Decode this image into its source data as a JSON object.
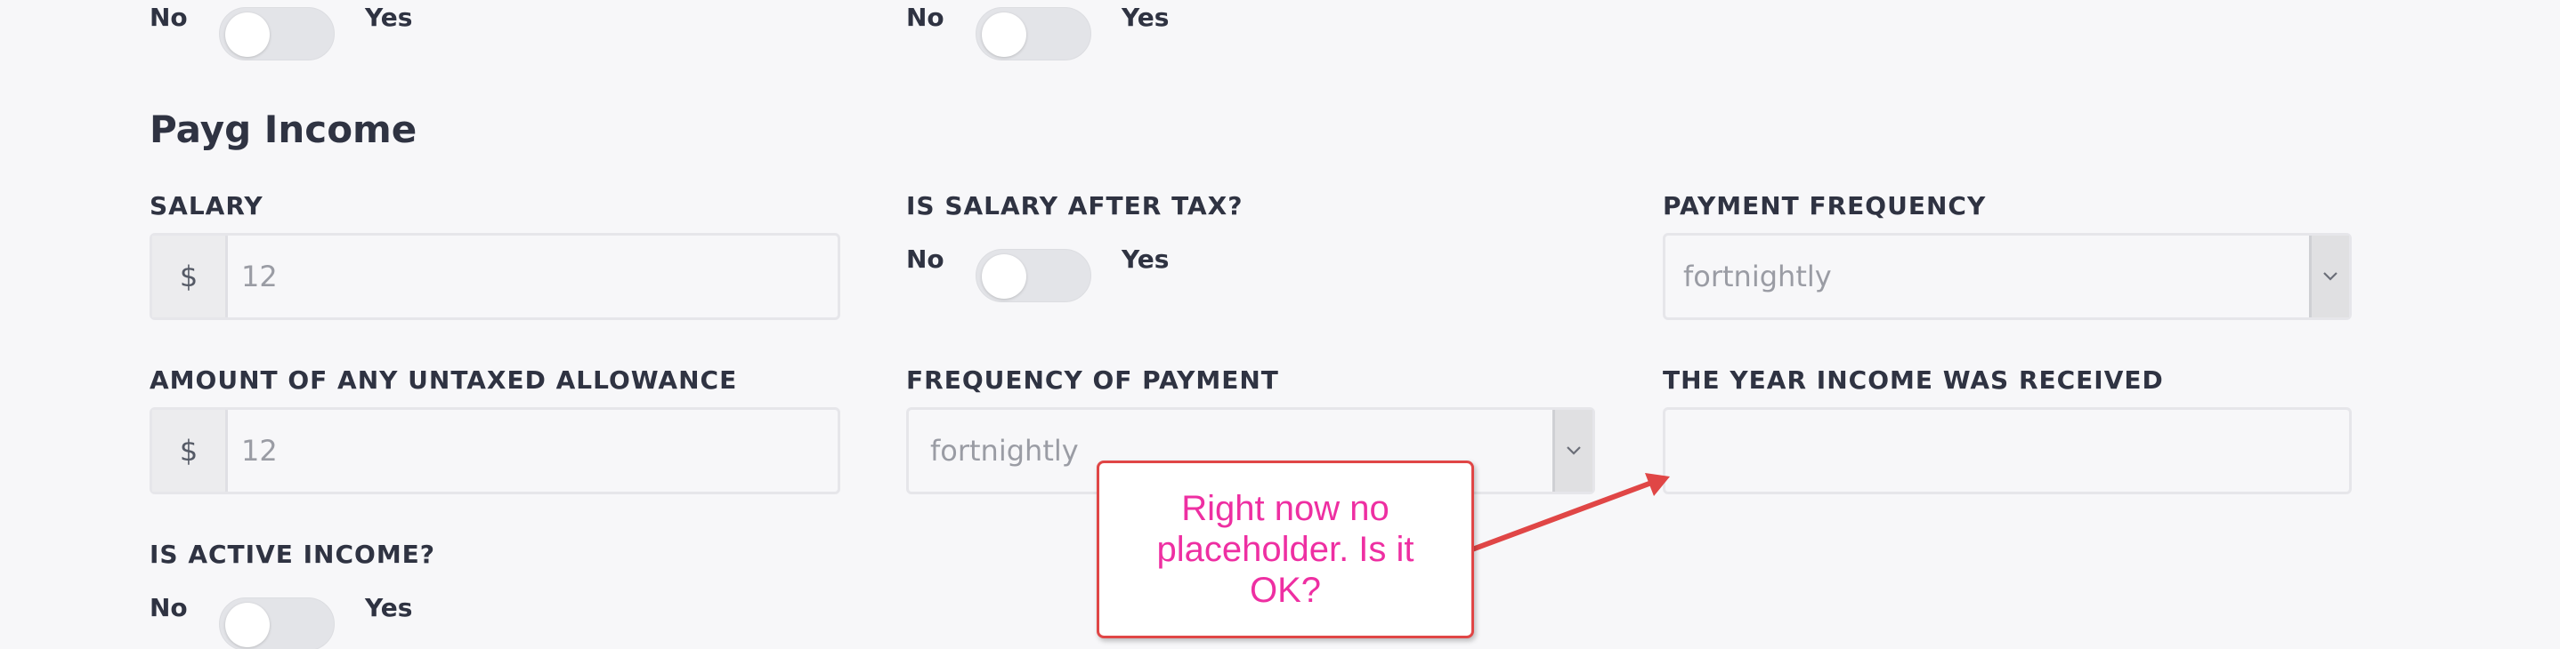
{
  "top_toggles": [
    {
      "no_label": "No",
      "yes_label": "Yes",
      "checked": false
    },
    {
      "no_label": "No",
      "yes_label": "Yes",
      "checked": false
    }
  ],
  "section": {
    "title": "Payg Income"
  },
  "salary": {
    "label": "SALARY",
    "prefix": "$",
    "value": "12"
  },
  "salary_after_tax": {
    "label": "IS SALARY AFTER TAX?",
    "no_label": "No",
    "yes_label": "Yes",
    "checked": false
  },
  "payment_frequency": {
    "label": "PAYMENT FREQUENCY",
    "value": "fortnightly"
  },
  "untaxed_allowance": {
    "label": "AMOUNT OF ANY UNTAXED ALLOWANCE",
    "prefix": "$",
    "value": "12"
  },
  "frequency_of_payment": {
    "label": "FREQUENCY OF PAYMENT",
    "value": "fortnightly"
  },
  "year_income_received": {
    "label": "THE YEAR INCOME WAS RECEIVED",
    "value": ""
  },
  "active_income": {
    "label": "IS ACTIVE INCOME?",
    "no_label": "No",
    "yes_label": "Yes",
    "checked": false
  },
  "annotation": {
    "text": "Right now no placeholder. Is it OK?",
    "text_color": "#ee2fa2",
    "border_color": "#e04646",
    "arrow_color": "#e04646"
  },
  "icons": {
    "select_arrow": "chevron-down-icon",
    "callout_arrow": "arrow-icon"
  }
}
